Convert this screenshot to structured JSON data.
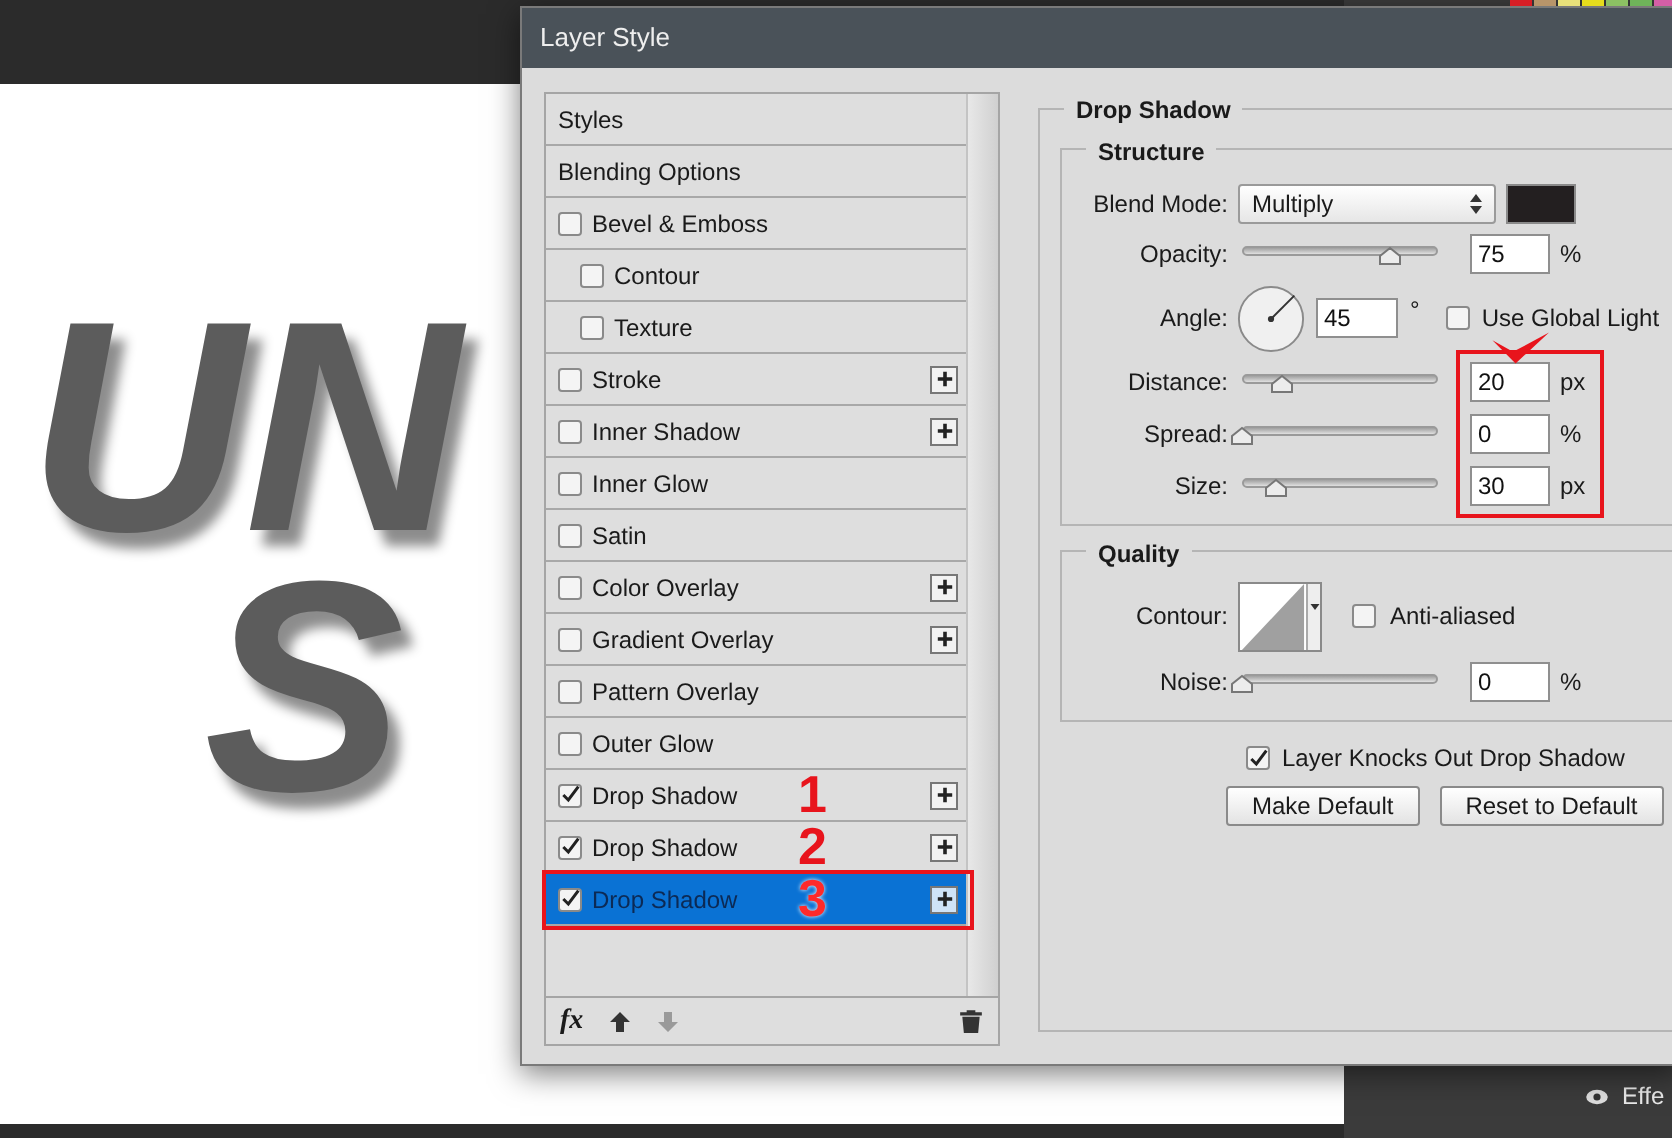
{
  "swatches": [
    {
      "color": "#d81f26"
    },
    {
      "color": "#b8956a"
    },
    {
      "color": "#e8e07a"
    },
    {
      "color": "#e6dc1c"
    },
    {
      "color": "#8cc063"
    },
    {
      "color": "#6fb35a"
    },
    {
      "color": "#d45fa6"
    }
  ],
  "canvas": {
    "lines": [
      "UN",
      "S"
    ]
  },
  "layers_panel": {
    "label": "Effe"
  },
  "dialog": {
    "title": "Layer Style",
    "styles_list": [
      {
        "kind": "header",
        "label": "Styles",
        "selected": false
      },
      {
        "kind": "header",
        "label": "Blending Options",
        "selected": false
      },
      {
        "kind": "check",
        "label": "Bevel & Emboss",
        "checked": false,
        "add": false,
        "selected": false
      },
      {
        "kind": "subcheck",
        "label": "Contour",
        "checked": false,
        "add": false,
        "selected": false
      },
      {
        "kind": "subcheck",
        "label": "Texture",
        "checked": false,
        "add": false,
        "selected": false
      },
      {
        "kind": "check",
        "label": "Stroke",
        "checked": false,
        "add": true,
        "selected": false
      },
      {
        "kind": "check",
        "label": "Inner Shadow",
        "checked": false,
        "add": true,
        "selected": false
      },
      {
        "kind": "check",
        "label": "Inner Glow",
        "checked": false,
        "add": false,
        "selected": false
      },
      {
        "kind": "check",
        "label": "Satin",
        "checked": false,
        "add": false,
        "selected": false
      },
      {
        "kind": "check",
        "label": "Color Overlay",
        "checked": false,
        "add": true,
        "selected": false
      },
      {
        "kind": "check",
        "label": "Gradient Overlay",
        "checked": false,
        "add": true,
        "selected": false
      },
      {
        "kind": "check",
        "label": "Pattern Overlay",
        "checked": false,
        "add": false,
        "selected": false
      },
      {
        "kind": "check",
        "label": "Outer Glow",
        "checked": false,
        "add": false,
        "selected": false
      },
      {
        "kind": "check",
        "label": "Drop Shadow",
        "checked": true,
        "add": true,
        "selected": false,
        "annotation": "1"
      },
      {
        "kind": "check",
        "label": "Drop Shadow",
        "checked": true,
        "add": true,
        "selected": false,
        "annotation": "2"
      },
      {
        "kind": "check",
        "label": "Drop Shadow",
        "checked": true,
        "add": true,
        "selected": true,
        "annotation": "3"
      }
    ],
    "list_toolbar": {
      "fx": "fx",
      "move_down_disabled": true
    },
    "section_title": "Drop Shadow",
    "structure": {
      "title": "Structure",
      "blend_mode": {
        "label": "Blend Mode:",
        "value": "Multiply",
        "color": "#231f20"
      },
      "rows": [
        {
          "kind": "slider",
          "label": "Opacity:",
          "value": "75",
          "unit": "%",
          "level": 0.75,
          "highlighted": false
        },
        {
          "kind": "angle",
          "label": "Angle:",
          "value": "45",
          "unit": "°",
          "global_light": {
            "label": "Use Global Light",
            "checked": false
          },
          "highlighted": false
        },
        {
          "kind": "slider",
          "label": "Distance:",
          "value": "20",
          "unit": "px",
          "level": 0.2,
          "highlighted": true
        },
        {
          "kind": "slider",
          "label": "Spread:",
          "value": "0",
          "unit": "%",
          "level": 0,
          "highlighted": true
        },
        {
          "kind": "slider",
          "label": "Size:",
          "value": "30",
          "unit": "px",
          "level": 0.17,
          "highlighted": true
        }
      ]
    },
    "quality": {
      "title": "Quality",
      "contour_label": "Contour:",
      "anti_aliased": {
        "label": "Anti-aliased",
        "checked": false
      },
      "noise": {
        "label": "Noise:",
        "value": "0",
        "unit": "%",
        "level": 0
      }
    },
    "knockout": {
      "label": "Layer Knocks Out Drop Shadow",
      "checked": true
    },
    "buttons": [
      "Make Default",
      "Reset to Default"
    ]
  }
}
